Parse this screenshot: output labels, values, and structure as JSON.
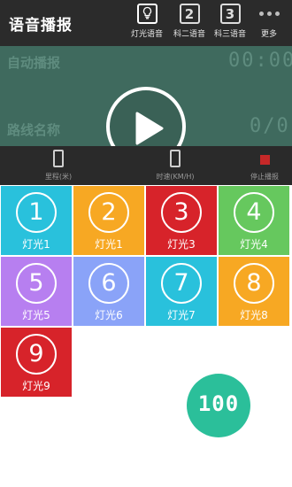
{
  "header": {
    "title": "语音播报",
    "tabs": [
      {
        "label": "灯光语音",
        "icon": "lightbulb-icon",
        "active": true
      },
      {
        "label": "科二语音",
        "icon_text": "2"
      },
      {
        "label": "科三语音",
        "icon_text": "3"
      },
      {
        "label": "更多",
        "icon": "more-dots-icon"
      }
    ]
  },
  "panel": {
    "auto_label": "自动播报",
    "clock": "00:00",
    "route_label": "路线名称",
    "route_progress": "0/0"
  },
  "stats": {
    "mileage_label": "里程(米)",
    "speed_label": "时速(KM/H)",
    "stop_label": "停止播报"
  },
  "lights": [
    {
      "number": "1",
      "label": "灯光1",
      "color": "#29c1dc"
    },
    {
      "number": "2",
      "label": "灯光1",
      "color": "#f7a823"
    },
    {
      "number": "3",
      "label": "灯光3",
      "color": "#d7232a"
    },
    {
      "number": "4",
      "label": "灯光4",
      "color": "#66c85e"
    },
    {
      "number": "5",
      "label": "灯光5",
      "color": "#b77ff0"
    },
    {
      "number": "6",
      "label": "灯光6",
      "color": "#8aa3f8"
    },
    {
      "number": "7",
      "label": "灯光7",
      "color": "#29c1dc"
    },
    {
      "number": "8",
      "label": "灯光8",
      "color": "#f7a823"
    },
    {
      "number": "9",
      "label": "灯光9",
      "color": "#d7232a"
    }
  ],
  "speed_button": {
    "value": "100",
    "color": "#2bbf9a"
  }
}
